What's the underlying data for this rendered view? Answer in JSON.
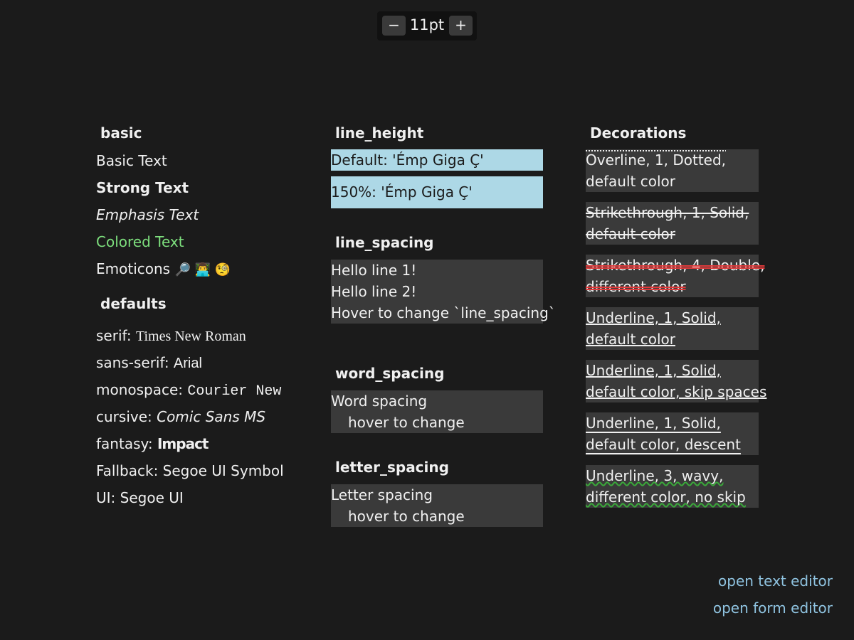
{
  "zoom": {
    "minus": "−",
    "value": "11pt",
    "plus": "+"
  },
  "basic": {
    "heading": "basic",
    "basic_text": "Basic Text",
    "strong_text": "Strong Text",
    "emphasis_text": "Emphasis Text",
    "colored_text": "Colored Text",
    "emoticons_label": "Emoticons",
    "emoticons": "🔎 👨‍💻 🧐",
    "colored_color": "#7ddf7d"
  },
  "defaults": {
    "heading": "defaults",
    "serif_label": "serif:",
    "serif_value": "Times New Roman",
    "sans_label": "sans-serif:",
    "sans_value": "Arial",
    "mono_label": "monospace:",
    "mono_value": "Courier New",
    "cursive_label": "cursive:",
    "cursive_value": "Comic Sans MS",
    "fantasy_label": "fantasy:",
    "fantasy_value": "Impact",
    "fallback_label": "Fallback:",
    "fallback_value": "Segoe UI Symbol",
    "ui_label": "UI:",
    "ui_value": "Segoe UI"
  },
  "line_height": {
    "heading": "line_height",
    "default_text": "Default: 'Émp Giga Ç'",
    "pct_text": "150%: 'Émp Giga Ç'"
  },
  "line_spacing": {
    "heading": "line_spacing",
    "lines": [
      "Hello line 1!",
      "Hello line 2!",
      "Hover to change `line_spacing`"
    ]
  },
  "word_spacing": {
    "heading": "word_spacing",
    "line1": "Word spacing",
    "line2": "hover to change"
  },
  "letter_spacing": {
    "heading": "letter_spacing",
    "line1": "Letter spacing",
    "line2": "hover to change"
  },
  "decorations": {
    "heading": "Decorations",
    "items": [
      {
        "line1": "Overline, 1, Dotted,",
        "line2": "default color"
      },
      {
        "line1": "Strikethrough, 1, Solid,",
        "line2": "default color"
      },
      {
        "line1": "Strikethrough, 4, Double,",
        "line2": "different color",
        "color": "#e03a3a"
      },
      {
        "line1": "Underline, 1, Solid,",
        "line2": "default color"
      },
      {
        "line1": "Underline, 1, Solid,",
        "line2": "default color, skip spaces"
      },
      {
        "line1": "Underline, 1, Solid,",
        "line2": "default color, descent"
      },
      {
        "line1": "Underline, 3, wavy,",
        "line2": "different color, no skip",
        "color": "#3aa83a"
      }
    ]
  },
  "links": {
    "text_editor": "open text editor",
    "form_editor": "open form editor",
    "color": "#8fc3e0"
  }
}
